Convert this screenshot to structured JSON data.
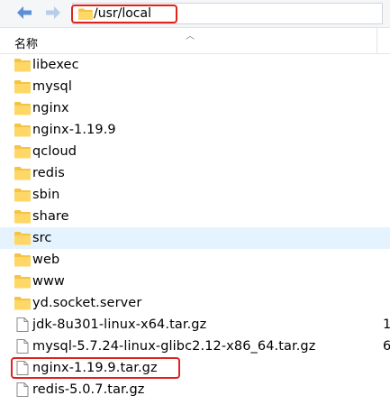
{
  "address_bar": {
    "path": "/usr/local"
  },
  "header": {
    "name_column": "名称"
  },
  "items": [
    {
      "name": "libexec",
      "type": "folder",
      "size": ""
    },
    {
      "name": "mysql",
      "type": "folder",
      "size": ""
    },
    {
      "name": "nginx",
      "type": "folder",
      "size": ""
    },
    {
      "name": "nginx-1.19.9",
      "type": "folder",
      "size": ""
    },
    {
      "name": "qcloud",
      "type": "folder",
      "size": ""
    },
    {
      "name": "redis",
      "type": "folder",
      "size": ""
    },
    {
      "name": "sbin",
      "type": "folder",
      "size": ""
    },
    {
      "name": "share",
      "type": "folder",
      "size": ""
    },
    {
      "name": "src",
      "type": "folder",
      "size": ""
    },
    {
      "name": "web",
      "type": "folder",
      "size": ""
    },
    {
      "name": "www",
      "type": "folder",
      "size": ""
    },
    {
      "name": "yd.socket.server",
      "type": "folder",
      "size": ""
    },
    {
      "name": "jdk-8u301-linux-x64.tar.gz",
      "type": "file",
      "size": "1"
    },
    {
      "name": "mysql-5.7.24-linux-glibc2.12-x86_64.tar.gz",
      "type": "file",
      "size": "6"
    },
    {
      "name": "nginx-1.19.9.tar.gz",
      "type": "file",
      "size": ""
    },
    {
      "name": "redis-5.0.7.tar.gz",
      "type": "file",
      "size": ""
    }
  ],
  "selected_item": "src",
  "highlighted_item": "nginx-1.19.9.tar.gz",
  "colors": {
    "folder": "#f6c445",
    "selection": "#e5f3ff",
    "highlight": "#e0231b",
    "nav_arrow": "#5b8fd6"
  }
}
